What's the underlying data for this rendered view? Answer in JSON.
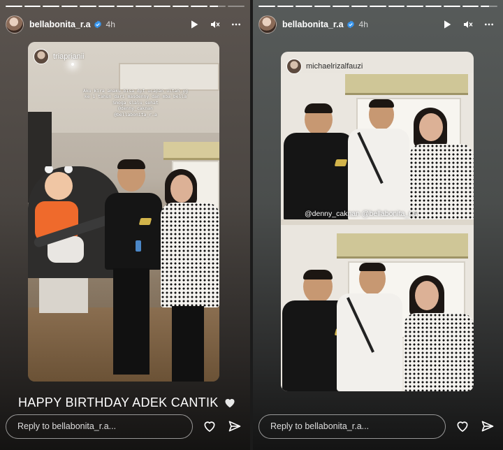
{
  "left_story": {
    "progress": [
      1,
      1,
      1,
      1,
      1,
      1,
      1,
      1,
      1,
      1,
      1,
      0.5,
      0
    ],
    "username": "bellabonita_r.a",
    "time": "4h",
    "repost_username": "triaprianii",
    "caption_lines": [
      "Aku kira anaku bisa dpt ucapan ultah yg",
      "ke 1 tahun dari masdenny dan mba bella",
      "Smoga slalu sehat",
      "@denny_caknan",
      "@bellabonita_r.a"
    ],
    "birthday_text": "HAPPY BIRTHDAY ADEK CANTIK",
    "reply_placeholder": "Reply to bellabonita_r.a..."
  },
  "right_story": {
    "progress": [
      1,
      1,
      1,
      1,
      1,
      1,
      1,
      1,
      1,
      1,
      1,
      1,
      0.5
    ],
    "username": "bellabonita_r.a",
    "time": "4h",
    "repost_username": "michaelrizalfauzi",
    "mention_text": "@denny_caknan @bellabonita_r.a",
    "reply_placeholder": "Reply to bellabonita_r.a..."
  },
  "icons": {
    "play": "play-icon",
    "mute": "mute-icon",
    "more": "more-icon",
    "like": "heart-icon",
    "share": "send-icon",
    "verified": "verified-badge-icon"
  },
  "colors": {
    "verified": "#3897f0",
    "text": "#ffffff"
  }
}
